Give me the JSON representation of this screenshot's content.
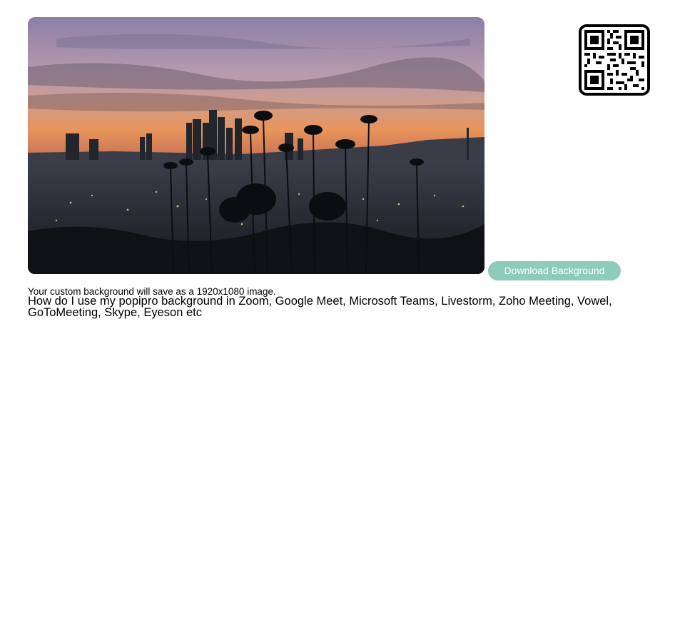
{
  "preview": {
    "image_name": "los-angeles-skyline-sunset-background",
    "alt": "Los Angeles skyline at sunset with palm trees"
  },
  "qr_code": {
    "icon": "qr-code-icon"
  },
  "actions": {
    "download_label": "Download Background",
    "download_color": "#8ecbbd"
  },
  "info": {
    "save_note": "Your custom background will save as a 1920x1080 image.",
    "howto_text": "How do I use my popipro background in Zoom, Google Meet, Microsoft Teams, Livestorm, Zoho Meeting, Vowel, GoToMeeting, Skype, Eyeson etc"
  }
}
